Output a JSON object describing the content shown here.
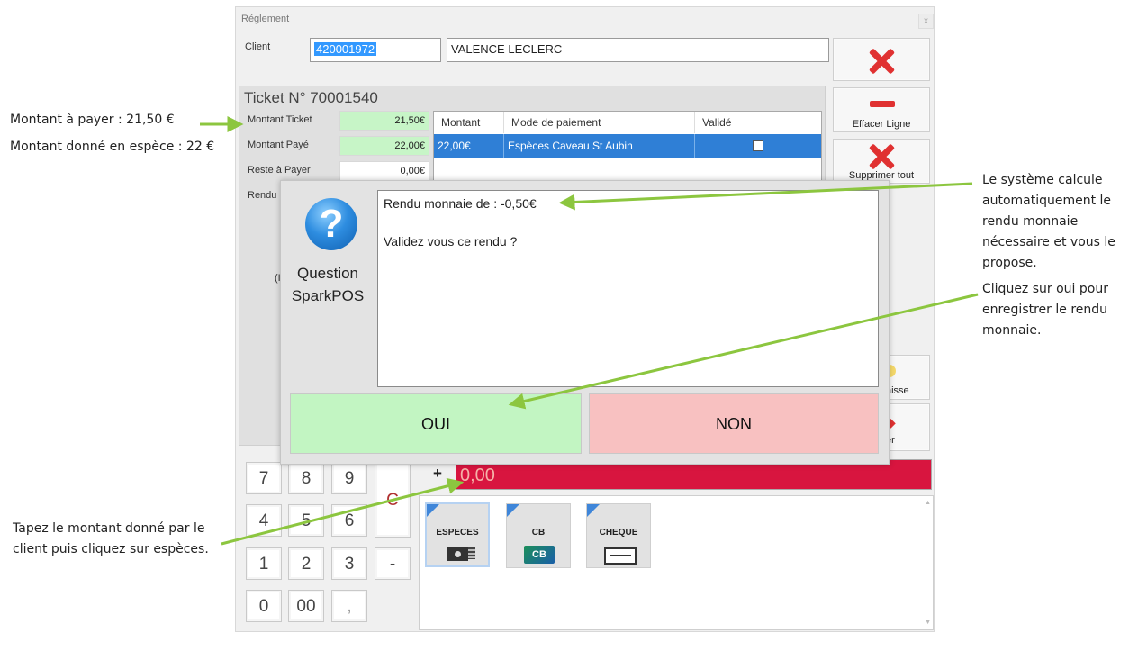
{
  "window": {
    "title": "Réglement",
    "close": "x"
  },
  "client": {
    "label": "Client",
    "code": "420001972",
    "name": "VALENCE LECLERC"
  },
  "side_buttons": {
    "effacer": "Effacer Ligne",
    "supprimer": "Supprimer tout",
    "caisse_partial": "aisse",
    "other_partial": "er"
  },
  "ticket": {
    "title": "Ticket N° 70001540",
    "rows": [
      {
        "label": "Montant Ticket",
        "value": "21,50€"
      },
      {
        "label": "Montant Payé",
        "value": "22,00€"
      },
      {
        "label": "Reste à Payer",
        "value": "0,00€"
      }
    ],
    "rendu_partial": "Rendu",
    "hidden_partial": "(I"
  },
  "payments_grid": {
    "headers": [
      "Montant",
      "Mode de paiement",
      "Validé"
    ],
    "rows": [
      {
        "montant": "22,00€",
        "mode": "Espèces Caveau St Aubin",
        "valide": false
      }
    ]
  },
  "dialog": {
    "title_line1": "Question",
    "title_line2": "SparkPOS",
    "icon": "question-icon",
    "message_line1": "Rendu monnaie de : -0,50€",
    "message_line2": "Validez vous ce rendu ?",
    "yes": "OUI",
    "no": "NON"
  },
  "keypad": {
    "keys": [
      "7",
      "8",
      "9",
      "4",
      "5",
      "6",
      "1",
      "2",
      "3",
      "0",
      "00",
      ","
    ],
    "clear": "C",
    "minus": "-",
    "plus": "+",
    "amount": "0,00"
  },
  "payment_modes": [
    {
      "label": "ESPECES",
      "icon": "cash-icon"
    },
    {
      "label": "CB",
      "icon": "card-icon"
    },
    {
      "label": "CHEQUE",
      "icon": "cheque-icon"
    }
  ],
  "annotations": {
    "left_top_1": "Montant à payer : 21,50 €",
    "left_top_2": "Montant donné en espèce : 22 €",
    "right_1": [
      "Le système calcule",
      "automatiquement le",
      "rendu monnaie",
      "nécessaire et vous le",
      "propose."
    ],
    "right_2": [
      "Cliquez sur oui pour",
      "enregistrer le rendu",
      "monnaie."
    ],
    "left_bottom": [
      "Tapez le montant donné par le",
      "client puis cliquez sur espèces."
    ]
  },
  "colors": {
    "arrow": "#8cc63f",
    "amount_bg": "#d8153f",
    "selected_row": "#2f7fd6",
    "oui_bg": "#c2f5c2",
    "non_bg": "#f8c1c1"
  }
}
